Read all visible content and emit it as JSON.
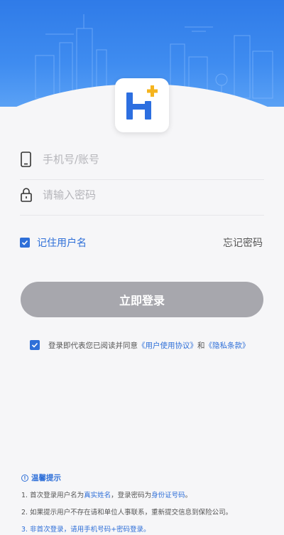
{
  "login": {
    "phone_placeholder": "手机号/账号",
    "password_placeholder": "请输入密码",
    "remember_label": "记住用户名",
    "remember_checked": true,
    "forgot_label": "忘记密码",
    "login_button": "立即登录"
  },
  "agreement": {
    "checked": true,
    "prefix": "登录即代表您已阅读并同意",
    "user_agreement": "《用户使用协议》",
    "and": "和",
    "privacy": "《隐私条款》"
  },
  "tips": {
    "title": "温馨提示",
    "line1": {
      "a": "1. 首次登录用户名为",
      "b": "真实姓名",
      "c": "，登录密码为",
      "d": "身份证号码",
      "e": "。"
    },
    "line2": "2. 如果提示用户不存在请和单位人事联系，重新提交信息到保险公司。",
    "line3": "3. 非首次登录，请用手机号码+密码登录。"
  },
  "colors": {
    "accent": "#2e6fd8",
    "header": "#3f8cf0",
    "button_disabled": "#a7a7ad",
    "logo_blue": "#2d6fe0",
    "logo_plus": "#f5b41e"
  },
  "icons": {
    "phone": "phone-icon",
    "lock": "lock-icon",
    "checkbox": "checkbox-checked-icon",
    "info": "info-icon"
  }
}
